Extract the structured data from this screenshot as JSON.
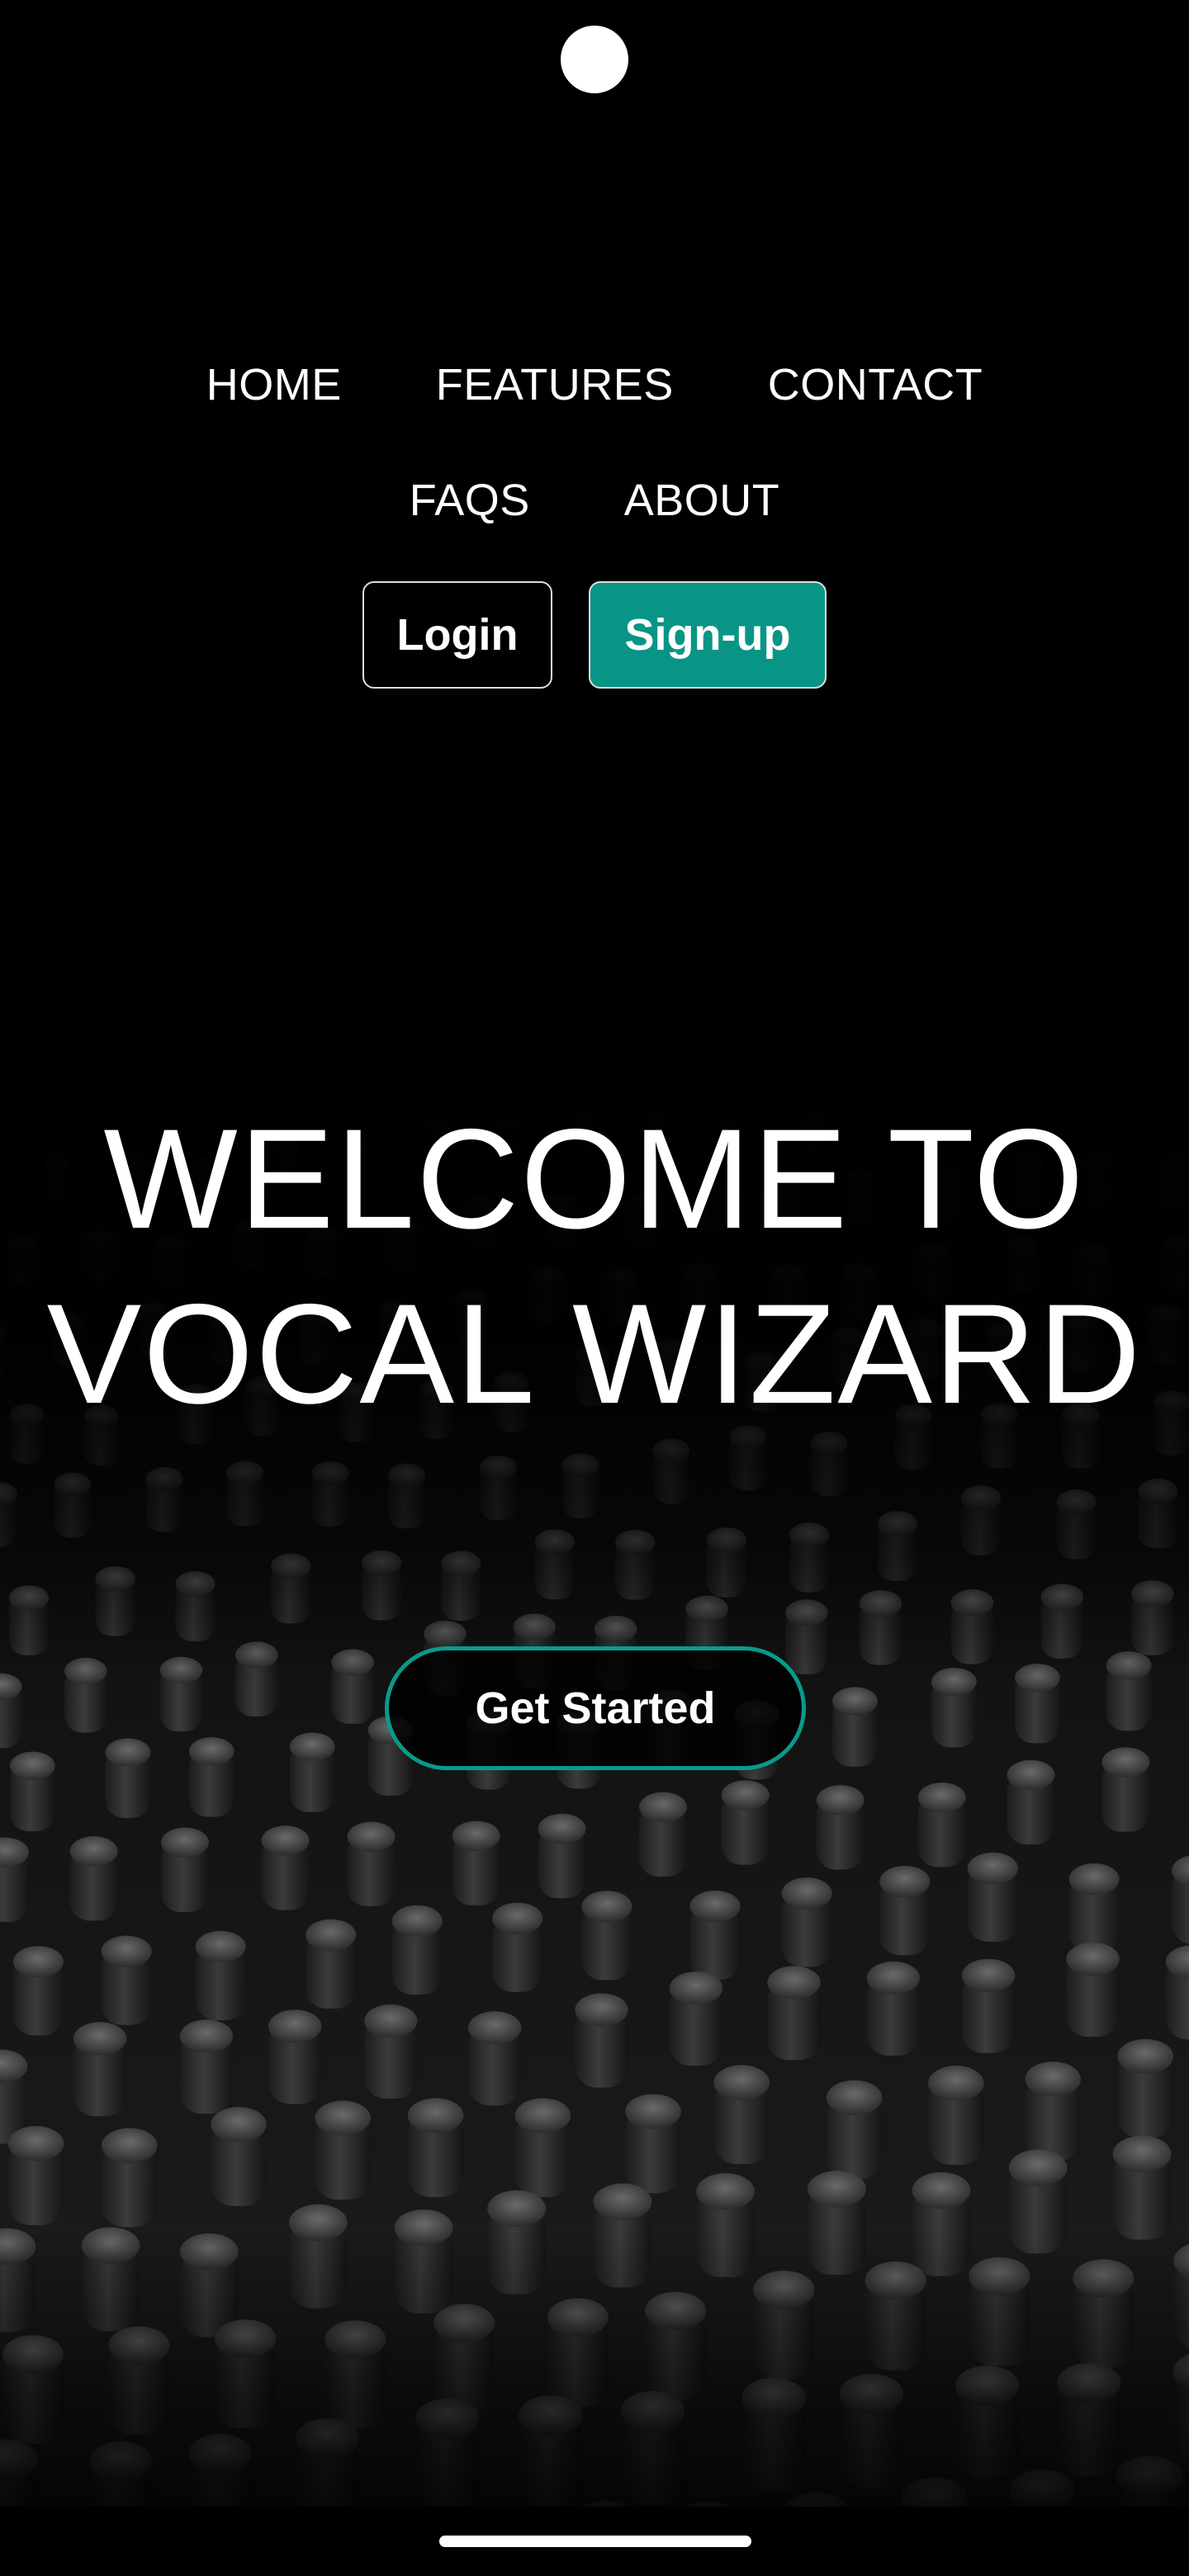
{
  "nav": {
    "row1": [
      "HOME",
      "FEATURES",
      "CONTACT"
    ],
    "row2": [
      "FAQS",
      "ABOUT"
    ]
  },
  "auth": {
    "login_label": "Login",
    "signup_label": "Sign-up"
  },
  "hero": {
    "title_line1": "WELCOME TO",
    "title_line2": "VOCAL WIZARD",
    "cta_label": "Get Started",
    "background_image": "mixing-console-photo"
  },
  "colors": {
    "background": "#000000",
    "accent": "#089586",
    "text": "#ffffff"
  }
}
